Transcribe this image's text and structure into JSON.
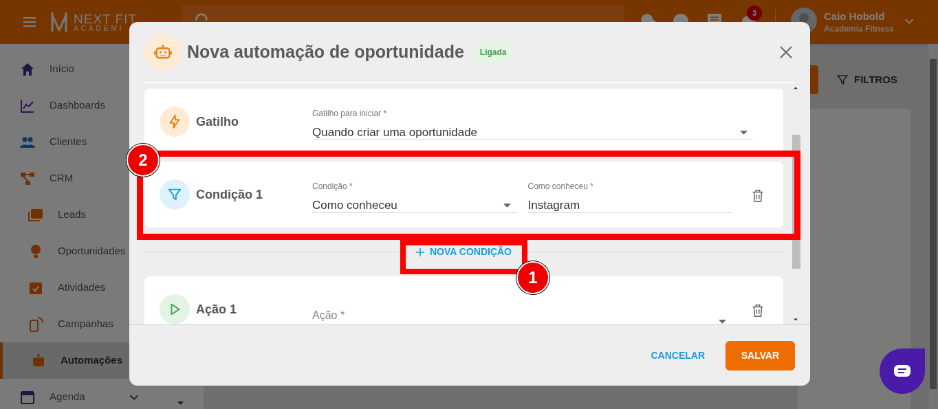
{
  "app_header": {
    "logo_title": "NEXT FIT",
    "logo_subtitle": "ACADEMI",
    "notification_count": "3",
    "user_name": "Caio Hobold",
    "user_org": "Academia Fitness"
  },
  "sidebar": {
    "items": [
      {
        "label": "Início",
        "selected": false
      },
      {
        "label": "Dashboards",
        "selected": false
      },
      {
        "label": "Clientes",
        "selected": false
      },
      {
        "label": "CRM",
        "selected": false,
        "children": [
          {
            "label": "Leads",
            "selected": false
          },
          {
            "label": "Oportunidades",
            "selected": false
          },
          {
            "label": "Atividades",
            "selected": false
          },
          {
            "label": "Campanhas",
            "selected": false
          },
          {
            "label": "Automações",
            "selected": true
          }
        ]
      },
      {
        "label": "Agenda",
        "selected": false,
        "expanded": false
      }
    ]
  },
  "toolbar": {
    "filter_button": "FILTROS"
  },
  "modal": {
    "title": "Nova automação de oportunidade",
    "status_badge": "Ligada",
    "sections": [
      {
        "kind": "trigger",
        "title": "Gatilho",
        "deletable": false,
        "fields": [
          {
            "kind": "select",
            "label": "Gatilho para iniciar *",
            "value": "Quando criar uma oportunidade"
          }
        ]
      },
      {
        "kind": "condition",
        "title": "Condição 1",
        "deletable": true,
        "fields": [
          {
            "kind": "select",
            "label": "Condição *",
            "value": "Como conheceu"
          },
          {
            "kind": "text",
            "label": "Como conheceu *",
            "value": "Instagram"
          }
        ]
      },
      {
        "kind": "action",
        "title": "Ação 1",
        "deletable": true,
        "fields": [
          {
            "kind": "select",
            "placeholder": "Ação *"
          }
        ]
      }
    ],
    "add_condition_button": "NOVA CONDIÇÃO",
    "cancel_button": "CANCELAR",
    "save_button": "SALVAR"
  },
  "annotations": [
    {
      "number": "2"
    },
    {
      "number": "1"
    }
  ]
}
